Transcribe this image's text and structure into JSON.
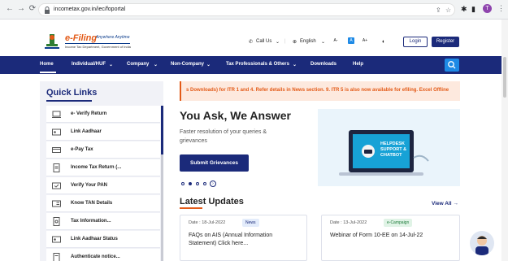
{
  "browser": {
    "url": "incometax.gov.in/iec/foportal",
    "profile_initial": "T"
  },
  "header": {
    "logo_title": "e-Filing",
    "logo_tagline": "Anywhere Anytime",
    "logo_subtitle": "Income Tax Department, Government of India",
    "call_us": "Call Us",
    "language": "English",
    "font_small": "A-",
    "font_normal": "A",
    "font_large": "A+",
    "login": "Login",
    "register": "Register"
  },
  "nav": {
    "items": [
      "Home",
      "Individual/HUF",
      "Company",
      "Non-Company",
      "Tax Professionals & Others",
      "Downloads",
      "Help"
    ]
  },
  "quick_links": {
    "title": "Quick Links",
    "items": [
      "e- Verify Return",
      "Link Aadhaar",
      "e-Pay Tax",
      "Income Tax Return (...",
      "Verify Your PAN",
      "Know TAN Details",
      "Tax Information...",
      "Link Aadhaar Status",
      "Authenticate notice..."
    ]
  },
  "ticker": {
    "text": "s Downloads) for ITR 1 and 4. Refer details in News section. 9. ITR 5 is also now available for efiling. Excel Offline"
  },
  "ask": {
    "title": "You Ask, We Answer",
    "subtitle": "Faster resolution of your queries & grievances",
    "button": "Submit Grievances",
    "helpdesk_line1": "HELPDESK",
    "helpdesk_line2": "SUPPORT &",
    "helpdesk_line3": "CHATBOT"
  },
  "latest_updates": {
    "title": "Latest Updates",
    "view_all": "View All",
    "cards": [
      {
        "date": "Date : 18-Jul-2022",
        "badge": "News",
        "text": "FAQs on AIS (Annual Information Statement) Click here..."
      },
      {
        "date": "Date : 13-Jul-2022",
        "badge": "e-Campaign",
        "text": "Webinar of Form 10-EE on 14-Jul-22"
      }
    ]
  },
  "colors": {
    "primary": "#1b2a7a",
    "accent": "#e35a17",
    "search": "#1e8ae6"
  }
}
